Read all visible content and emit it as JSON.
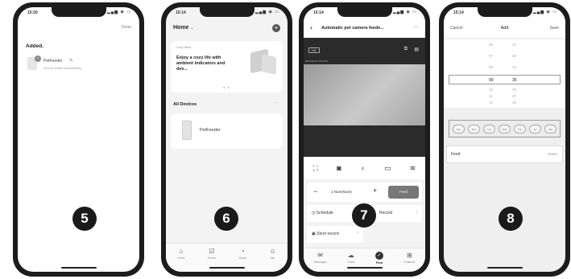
{
  "phones": {
    "p5": {
      "step": "5",
      "status_time": "15:20",
      "done": "Done",
      "added": "Added.",
      "device_name": "PetFeeder",
      "device_sub": "Device added successfully"
    },
    "p6": {
      "step": "6",
      "status_time": "15:14",
      "home_title": "Home",
      "banner_tag": "Cozy Home",
      "banner_text": "Enjoy a cozy life with ambient indicators and dev...",
      "all_devices": "All Devices",
      "more": "···",
      "device_name": "PetFeeder",
      "tabs": [
        "Home",
        "Scene",
        "Smart",
        "Me"
      ]
    },
    "p7": {
      "step": "7",
      "status_time": "15:14",
      "title": "Automatic pet camera feede...",
      "hd": "HD",
      "timestamp": "2022-02-10 15:14:22",
      "portion": "1 Num(Num)",
      "feed_button": "Feed",
      "schedule": "Schedule",
      "record": "Record",
      "short_record": "Short record",
      "tabs": [
        "Messages",
        "Cloud",
        "Feed",
        "Features"
      ]
    },
    "p8": {
      "step": "8",
      "status_time": "15:14",
      "cancel": "Cancel",
      "title": "Add",
      "save": "Save",
      "picker": {
        "rows": [
          {
            "h": "06",
            "m": "32"
          },
          {
            "h": "07",
            "m": "33"
          },
          {
            "h": "08",
            "m": "34"
          },
          {
            "h": "10",
            "m": "36"
          },
          {
            "h": "11",
            "m": "37"
          },
          {
            "h": "12",
            "m": "38"
          }
        ],
        "selected": {
          "h": "09",
          "m": "35"
        }
      },
      "days": [
        "Sun",
        "Mon",
        "Tue",
        "Wed",
        "Thu",
        "Fri",
        "Sat"
      ],
      "feed_label": "Feed",
      "feed_value": "1Num"
    }
  }
}
